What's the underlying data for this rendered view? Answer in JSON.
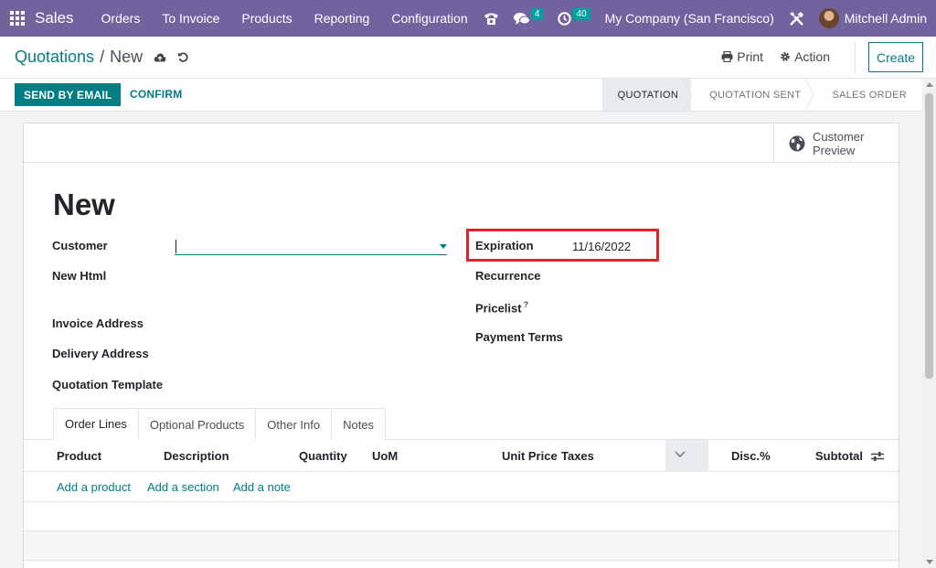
{
  "navbar": {
    "app_name": "Sales",
    "menu": [
      "Orders",
      "To Invoice",
      "Products",
      "Reporting",
      "Configuration"
    ],
    "messages_badge": "4",
    "activities_badge": "40",
    "company": "My Company (San Francisco)",
    "user": "Mitchell Admin"
  },
  "control": {
    "breadcrumb_parent": "Quotations",
    "breadcrumb_separator": "/",
    "breadcrumb_current": "New",
    "print_label": "Print",
    "action_label": "Action",
    "create_label": "Create"
  },
  "statusbar": {
    "send_email_label": "SEND BY EMAIL",
    "confirm_label": "CONFIRM",
    "stages": [
      "QUOTATION",
      "QUOTATION SENT",
      "SALES ORDER"
    ],
    "active_stage": "QUOTATION"
  },
  "form": {
    "preview_line1": "Customer",
    "preview_line2": "Preview",
    "title": "New",
    "left_fields": {
      "customer": "Customer",
      "new_html": "New Html",
      "invoice_address": "Invoice Address",
      "delivery_address": "Delivery Address",
      "quotation_template": "Quotation Template"
    },
    "right_fields": {
      "expiration": "Expiration",
      "expiration_value": "11/16/2022",
      "recurrence": "Recurrence",
      "pricelist": "Pricelist",
      "pricelist_help": "?",
      "payment_terms": "Payment Terms"
    }
  },
  "tabs": [
    "Order Lines",
    "Optional Products",
    "Other Info",
    "Notes"
  ],
  "table": {
    "columns": {
      "product": "Product",
      "description": "Description",
      "quantity": "Quantity",
      "uom": "UoM",
      "unit_price": "Unit Price",
      "taxes": "Taxes",
      "disc": "Disc.%",
      "subtotal": "Subtotal"
    },
    "add_product": "Add a product",
    "add_section": "Add a section",
    "add_note": "Add a note"
  },
  "colors": {
    "navbar": "#71639e",
    "primary": "#017e84",
    "highlight": "#e3202c",
    "badge": "#00a09d"
  }
}
